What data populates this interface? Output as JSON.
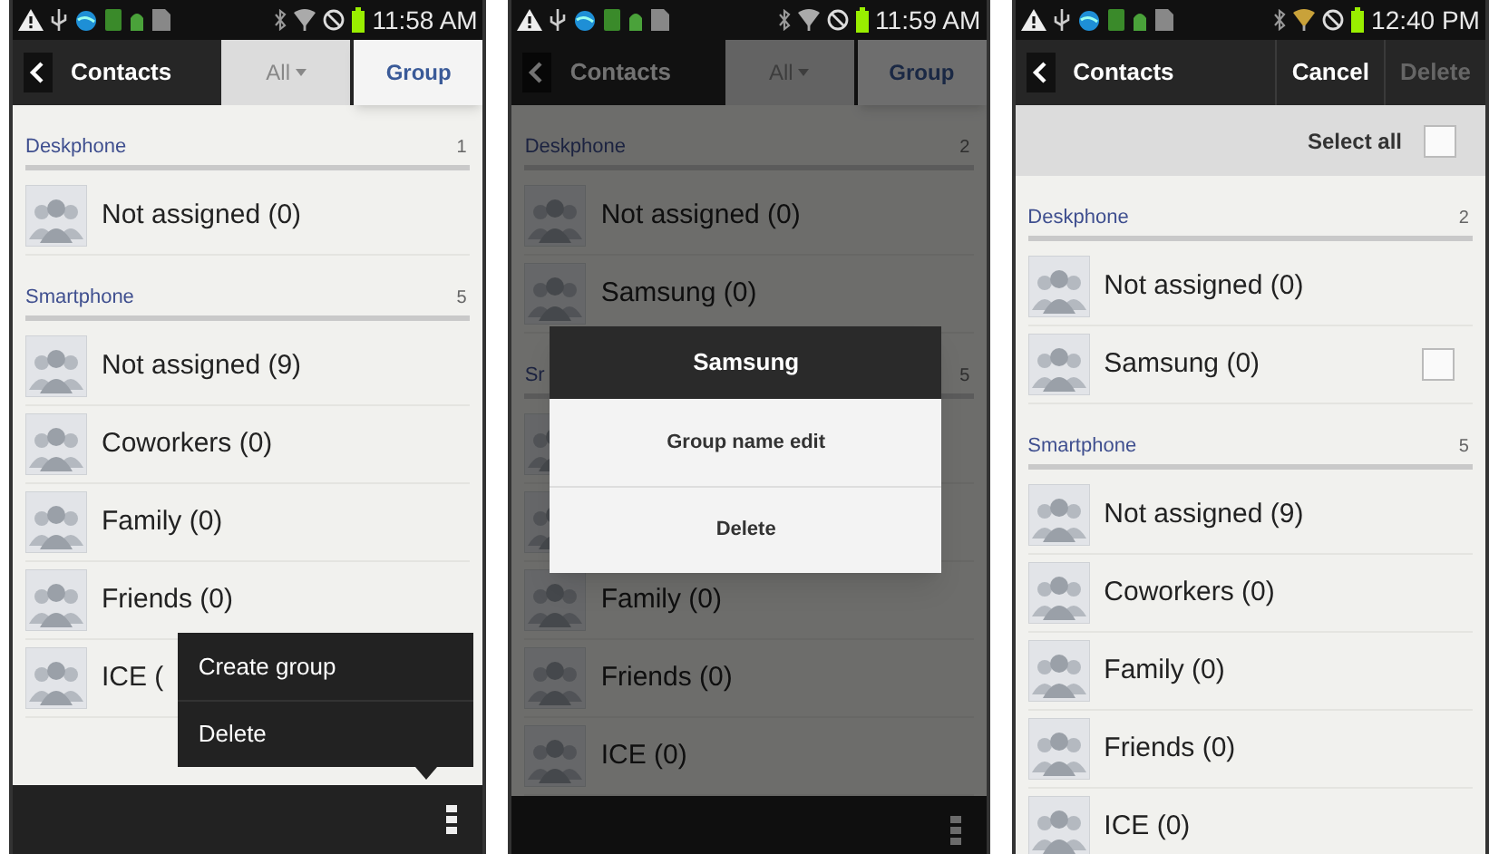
{
  "phones": [
    {
      "status_bar": {
        "time": "11:58 AM"
      },
      "action_bar": {
        "title": "Contacts",
        "tabs": [
          {
            "label": "All",
            "selected": false
          },
          {
            "label": "Group",
            "selected": true
          }
        ]
      },
      "dimmed": false,
      "list": [
        {
          "kind": "section",
          "label": "Deskphone",
          "count": "1"
        },
        {
          "kind": "group",
          "label": "Not assigned (0)"
        },
        {
          "kind": "section",
          "label": "Smartphone",
          "count": "5"
        },
        {
          "kind": "group",
          "label": "Not assigned (9)"
        },
        {
          "kind": "group",
          "label": "Coworkers (0)"
        },
        {
          "kind": "group",
          "label": "Family (0)"
        },
        {
          "kind": "group",
          "label": "Friends (0)"
        },
        {
          "kind": "group",
          "label": "ICE ("
        }
      ],
      "menu_bar": true,
      "overflow_menu": [
        "Create group",
        "Delete"
      ]
    },
    {
      "status_bar": {
        "time": "11:59 AM"
      },
      "action_bar": {
        "title": "Contacts",
        "tabs": [
          {
            "label": "All",
            "selected": false
          },
          {
            "label": "Group",
            "selected": true
          }
        ]
      },
      "dimmed": true,
      "list": [
        {
          "kind": "section",
          "label": "Deskphone",
          "count": "2"
        },
        {
          "kind": "group",
          "label": "Not assigned (0)"
        },
        {
          "kind": "group",
          "label": "Samsung (0)"
        },
        {
          "kind": "section",
          "label": "Sr",
          "count": "5"
        },
        {
          "kind": "group"
        },
        {
          "kind": "group"
        },
        {
          "kind": "group",
          "label": "Family (0)"
        },
        {
          "kind": "group",
          "label": "Friends (0)"
        },
        {
          "kind": "group",
          "label": "ICE (0)"
        }
      ],
      "menu_bar": true,
      "dialog": {
        "title": "Samsung",
        "options": [
          "Group name edit",
          "Delete"
        ]
      }
    },
    {
      "status_bar": {
        "time": "12:40 PM"
      },
      "action_bar": {
        "title": "Contacts",
        "buttons": [
          {
            "label": "Cancel",
            "disabled": false
          },
          {
            "label": "Delete",
            "disabled": true
          }
        ]
      },
      "dimmed": false,
      "select_all": {
        "label": "Select all",
        "checked": false
      },
      "list": [
        {
          "kind": "section",
          "label": "Deskphone",
          "count": "2"
        },
        {
          "kind": "group",
          "label": "Not assigned (0)"
        },
        {
          "kind": "selectable",
          "label": "Samsung (0)",
          "checked": false
        },
        {
          "kind": "section",
          "label": "Smartphone",
          "count": "5"
        },
        {
          "kind": "group",
          "label": "Not assigned (9)"
        },
        {
          "kind": "group",
          "label": "Coworkers (0)"
        },
        {
          "kind": "group",
          "label": "Family (0)"
        },
        {
          "kind": "group",
          "label": "Friends (0)"
        },
        {
          "kind": "group",
          "label": "ICE (0)"
        }
      ],
      "menu_bar": false
    }
  ]
}
